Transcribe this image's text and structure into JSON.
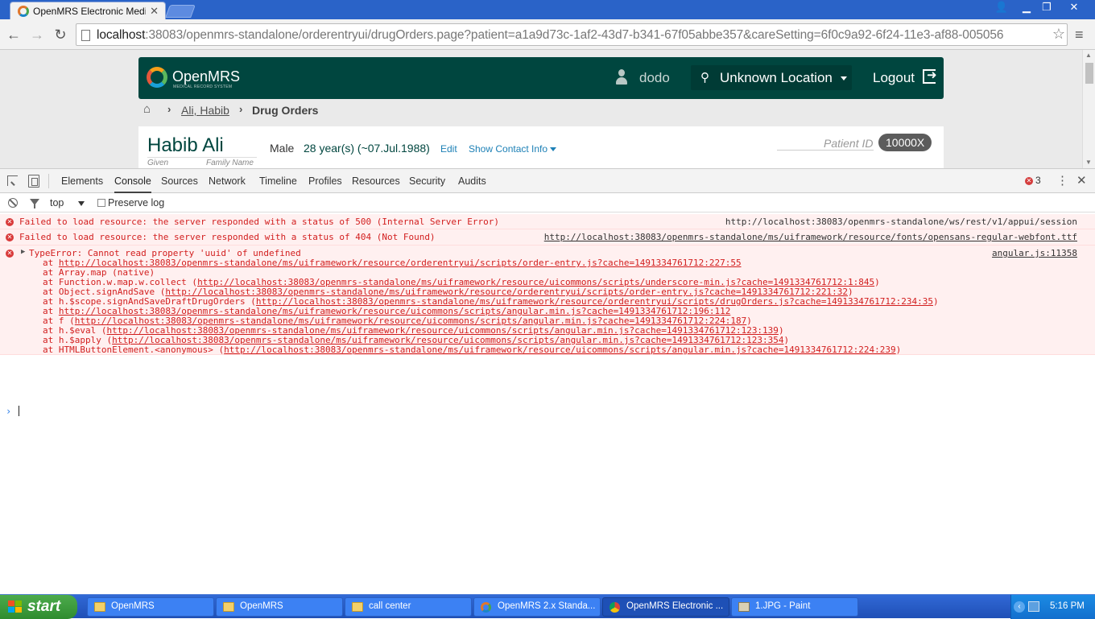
{
  "browser": {
    "tab_title": "OpenMRS Electronic Medical",
    "url_host": "localhost",
    "url_rest": ":38083/openmrs-standalone/orderentryui/drugOrders.page?patient=a1a9d73c-1af2-43d7-b341-67f05abbe357&careSetting=6f0c9a92-6f24-11e3-af88-005056"
  },
  "header": {
    "logo_text": "OpenMRS",
    "logo_sub": "MEDICAL RECORD SYSTEM",
    "user": "dodo",
    "location": "Unknown Location",
    "logout": "Logout"
  },
  "breadcrumb": {
    "patient": "Ali, Habib",
    "current": "Drug Orders"
  },
  "patient": {
    "given": "Habib",
    "family": "Ali",
    "given_label": "Given",
    "family_label": "Family Name",
    "gender": "Male",
    "age": "28 year(s) (~07.Jul.1988)",
    "edit": "Edit",
    "show_contact": "Show Contact Info",
    "id_label": "Patient ID",
    "id_value": "10000X"
  },
  "devtools": {
    "tabs": [
      "Elements",
      "Console",
      "Sources",
      "Network",
      "Timeline",
      "Profiles",
      "Resources",
      "Security",
      "Audits"
    ],
    "active_tab": "Console",
    "error_count": "3",
    "context": "top",
    "preserve_log": "Preserve log"
  },
  "console": {
    "messages": [
      {
        "text": "Failed to load resource: the server responded with a status of 500 (Internal Server Error)",
        "source": "http://localhost:38083/openmrs-standalone/ws/rest/v1/appui/session"
      },
      {
        "text": "Failed to load resource: the server responded with a status of 404 (Not Found)",
        "source": "http://localhost:38083/openmrs-standalone/ms/uiframework/resource/fonts/opensans-regular-webfont.ttf"
      }
    ],
    "exception": {
      "text": "TypeError: Cannot read property 'uuid' of undefined",
      "source": "angular.js:11358",
      "stack": [
        {
          "prefix": "at ",
          "link": "http://localhost:38083/openmrs-standalone/ms/uiframework/resource/orderentryui/scripts/order-entry.js?cache=1491334761712:227:55",
          "suffix": ""
        },
        {
          "prefix": "at Array.map (native)",
          "link": "",
          "suffix": ""
        },
        {
          "prefix": "at Function.w.map.w.collect (",
          "link": "http://localhost:38083/openmrs-standalone/ms/uiframework/resource/uicommons/scripts/underscore-min.js?cache=1491334761712:1:845",
          "suffix": ")"
        },
        {
          "prefix": "at Object.signAndSave (",
          "link": "http://localhost:38083/openmrs-standalone/ms/uiframework/resource/orderentryui/scripts/order-entry.js?cache=1491334761712:221:32",
          "suffix": ")"
        },
        {
          "prefix": "at h.$scope.signAndSaveDraftDrugOrders (",
          "link": "http://localhost:38083/openmrs-standalone/ms/uiframework/resource/orderentryui/scripts/drugOrders.js?cache=1491334761712:234:35",
          "suffix": ")"
        },
        {
          "prefix": "at ",
          "link": "http://localhost:38083/openmrs-standalone/ms/uiframework/resource/uicommons/scripts/angular.min.js?cache=1491334761712:196:112",
          "suffix": ""
        },
        {
          "prefix": "at f (",
          "link": "http://localhost:38083/openmrs-standalone/ms/uiframework/resource/uicommons/scripts/angular.min.js?cache=1491334761712:224:187",
          "suffix": ")"
        },
        {
          "prefix": "at h.$eval (",
          "link": "http://localhost:38083/openmrs-standalone/ms/uiframework/resource/uicommons/scripts/angular.min.js?cache=1491334761712:123:139",
          "suffix": ")"
        },
        {
          "prefix": "at h.$apply (",
          "link": "http://localhost:38083/openmrs-standalone/ms/uiframework/resource/uicommons/scripts/angular.min.js?cache=1491334761712:123:354",
          "suffix": ")"
        },
        {
          "prefix": "at HTMLButtonElement.<anonymous> (",
          "link": "http://localhost:38083/openmrs-standalone/ms/uiframework/resource/uicommons/scripts/angular.min.js?cache=1491334761712:224:239",
          "suffix": ")"
        }
      ]
    }
  },
  "taskbar": {
    "start": "start",
    "tasks": [
      {
        "label": "OpenMRS",
        "icon": "folder-icon"
      },
      {
        "label": "OpenMRS",
        "icon": "folder-icon"
      },
      {
        "label": "call center",
        "icon": "folder-icon"
      },
      {
        "label": "OpenMRS 2.x Standa...",
        "icon": "openmrs-icon"
      },
      {
        "label": "OpenMRS Electronic ...",
        "icon": "chrome-icon"
      },
      {
        "label": "1.JPG - Paint",
        "icon": "paint-icon"
      }
    ],
    "time": "5:16 PM"
  }
}
